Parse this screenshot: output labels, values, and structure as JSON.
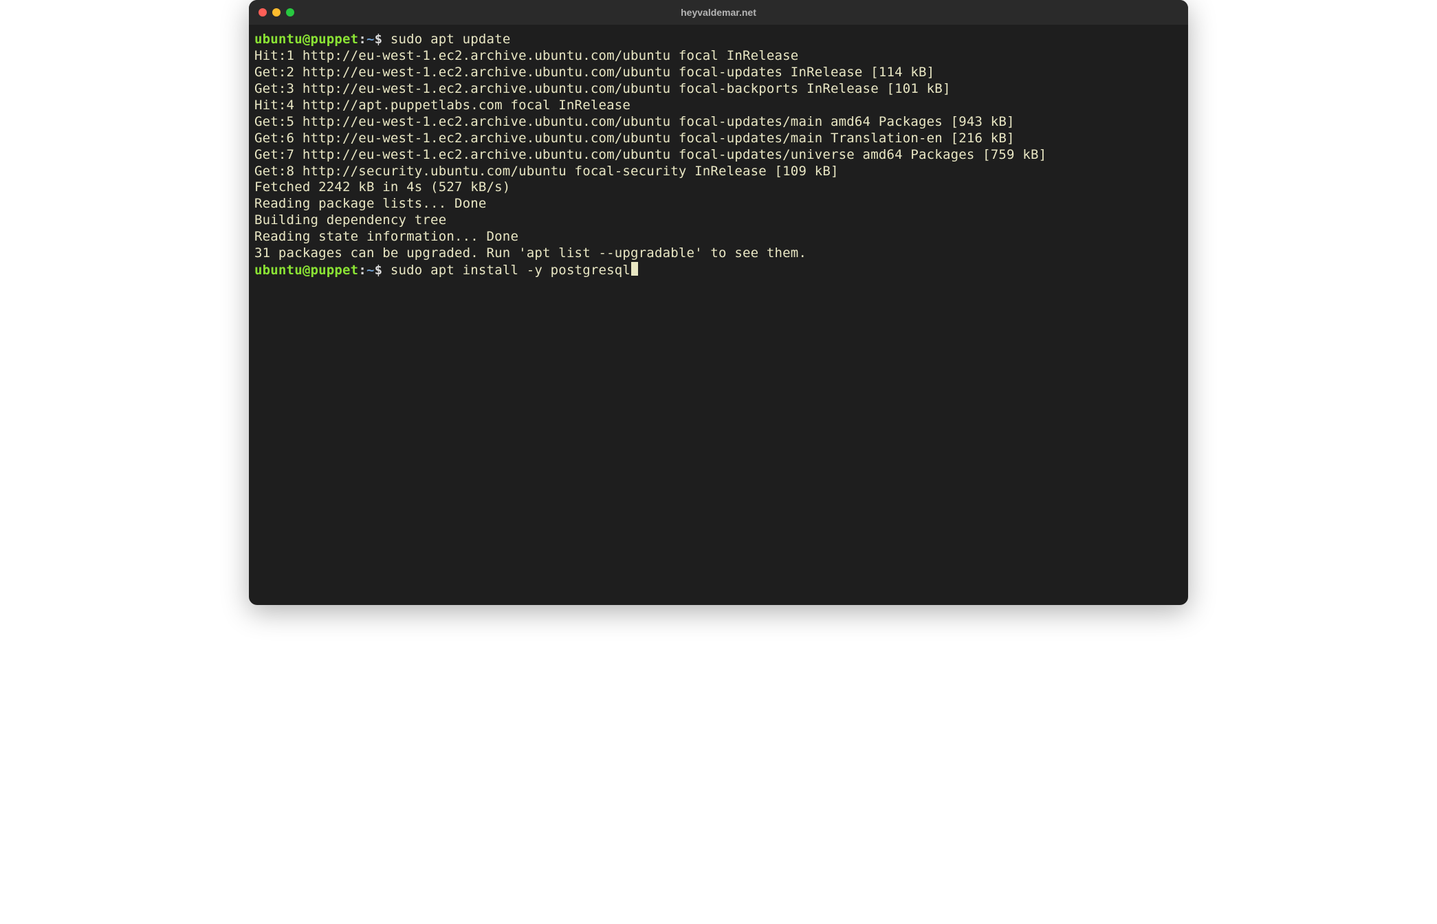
{
  "window": {
    "title": "heyvaldemar.net"
  },
  "prompt": {
    "user": "ubuntu",
    "at": "@",
    "host": "puppet",
    "colon": ":",
    "path": "~",
    "dollar": "$"
  },
  "commands": {
    "cmd1": "sudo apt update",
    "cmd2": "sudo apt install -y postgresql"
  },
  "output": {
    "l1": "Hit:1 http://eu-west-1.ec2.archive.ubuntu.com/ubuntu focal InRelease",
    "l2": "Get:2 http://eu-west-1.ec2.archive.ubuntu.com/ubuntu focal-updates InRelease [114 kB]",
    "l3": "Get:3 http://eu-west-1.ec2.archive.ubuntu.com/ubuntu focal-backports InRelease [101 kB]",
    "l4": "Hit:4 http://apt.puppetlabs.com focal InRelease",
    "l5": "Get:5 http://eu-west-1.ec2.archive.ubuntu.com/ubuntu focal-updates/main amd64 Packages [943 kB]",
    "l6": "Get:6 http://eu-west-1.ec2.archive.ubuntu.com/ubuntu focal-updates/main Translation-en [216 kB]",
    "l7": "Get:7 http://eu-west-1.ec2.archive.ubuntu.com/ubuntu focal-updates/universe amd64 Packages [759 kB]",
    "l8": "Get:8 http://security.ubuntu.com/ubuntu focal-security InRelease [109 kB]",
    "l9": "Fetched 2242 kB in 4s (527 kB/s)",
    "l10": "Reading package lists... Done",
    "l11": "Building dependency tree",
    "l12": "Reading state information... Done",
    "l13": "31 packages can be upgraded. Run 'apt list --upgradable' to see them."
  }
}
